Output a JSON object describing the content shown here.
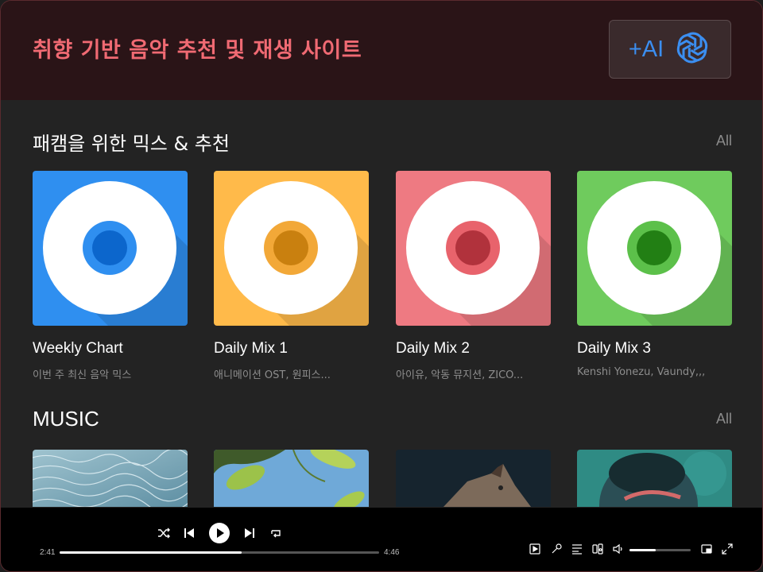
{
  "header": {
    "title": "취향 기반 음악 추천 및 재생 사이트",
    "ai_button_label": "+AI",
    "ai_icon": "openai-logo-icon"
  },
  "mix_section": {
    "title": "패캠을 위한 믹스 & 추천",
    "all_label": "All",
    "cards": [
      {
        "title": "Weekly Chart",
        "subtitle": "이번 주 최신 음악 믹스",
        "color": "#2f8ff0",
        "inner_color": "#0c66cc",
        "ring_color": "#2f8ff0"
      },
      {
        "title": "Daily Mix 1",
        "subtitle": "애니메이션 OST, 원피스...",
        "color": "#ffba4a",
        "inner_color": "#c9800f",
        "ring_color": "#f2a838"
      },
      {
        "title": "Daily Mix 2",
        "subtitle": "아이유, 악동 뮤지션, ZICO...",
        "color": "#ee7a82",
        "inner_color": "#b1323c",
        "ring_color": "#e8636c"
      },
      {
        "title": "Daily Mix 3",
        "subtitle": "Kenshi Yonezu, Vaundy,,,",
        "color": "#6fcb5d",
        "inner_color": "#227f14",
        "ring_color": "#5cc04a"
      }
    ]
  },
  "music_section": {
    "title": "MUSIC",
    "all_label": "All"
  },
  "player": {
    "current_time": "2:41",
    "total_time": "4:46",
    "progress": 0.57,
    "volume": 0.43,
    "controls": [
      "shuffle-icon",
      "previous-icon",
      "play-icon",
      "next-icon",
      "repeat-icon"
    ],
    "right_controls": [
      "now-playing-icon",
      "lyrics-icon",
      "queue-icon",
      "connect-device-icon",
      "volume-icon",
      "mini-player-icon",
      "fullscreen-icon"
    ]
  }
}
